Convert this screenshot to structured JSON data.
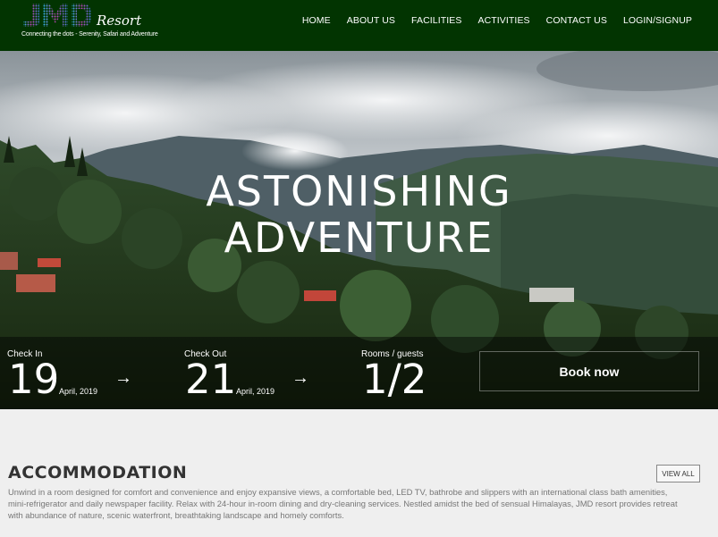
{
  "header": {
    "logo_text": "JMD",
    "logo_script": "Resort",
    "tagline": "Connecting the dots - Serenity, Safari and Adventure",
    "nav": [
      "HOME",
      "ABOUT US",
      "FACILITIES",
      "ACTIVITIES",
      "CONTACT US",
      "LOGIN/SIGNUP"
    ]
  },
  "hero": {
    "line1": "ASTONISHING",
    "line2": "ADVENTURE"
  },
  "booking": {
    "checkin_label": "Check In",
    "checkin_day": "19",
    "checkin_month": "April, 2019",
    "checkout_label": "Check Out",
    "checkout_day": "21",
    "checkout_month": "April, 2019",
    "rooms_label": "Rooms / guests",
    "rooms_value": "1/2",
    "arrow": "→",
    "book_label": "Book now"
  },
  "accommodation": {
    "title": "ACCOMMODATION",
    "view_all": "VIEW ALL",
    "description": "Unwind in a room designed for comfort and convenience and enjoy expansive views, a comfortable bed, LED TV, bathrobe and slippers with an international class bath amenities, mini-refrigerator and daily newspaper facility. Relax with 24-hour in-room dining and dry-cleaning services. Nestled amidst the bed of sensual Himalayas, JMD resort provides retreat with abundance of nature, scenic waterfront, breathtaking landscape and homely comforts."
  },
  "colors": {
    "header_bg": "#023401",
    "page_bg": "#efefef",
    "text_muted": "#777777"
  }
}
